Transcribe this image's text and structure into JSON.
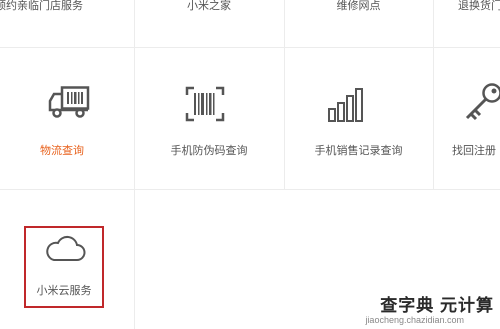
{
  "top_row": [
    {
      "label": "预约亲临门店服务"
    },
    {
      "label": "小米之家"
    },
    {
      "label": "维修网点"
    },
    {
      "label": "退换货门店"
    }
  ],
  "middle_row": [
    {
      "label": "物流查询",
      "icon": "truck-icon",
      "active": true
    },
    {
      "label": "手机防伪码查询",
      "icon": "barcode-scan-icon"
    },
    {
      "label": "手机销售记录查询",
      "icon": "bar-chart-icon"
    },
    {
      "label": "找回注册",
      "icon": "key-icon"
    }
  ],
  "bottom_row": [
    {
      "label": "小米云服务",
      "icon": "cloud-icon",
      "highlighted": true
    }
  ],
  "watermark": {
    "main": "查字典 元计算",
    "sub": "jiaocheng.chazidian.com"
  },
  "colors": {
    "active_label": "#e8611c",
    "highlight_border": "#c0282a",
    "icon": "#555555",
    "divider": "#ececec"
  }
}
